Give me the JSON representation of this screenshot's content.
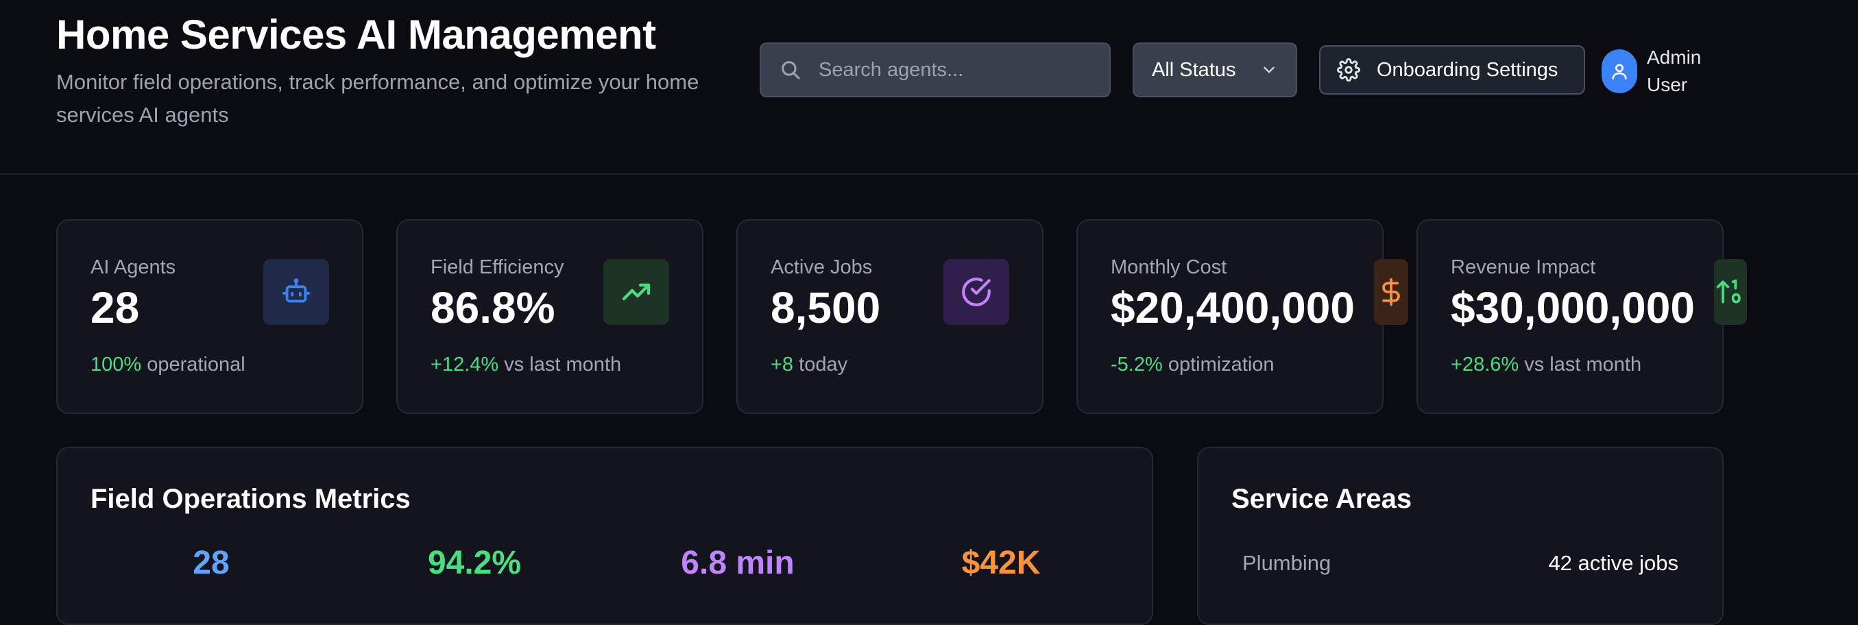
{
  "header": {
    "title": "Home Services AI Management",
    "subtitle": "Monitor field operations, track performance, and optimize your home services AI agents",
    "search_placeholder": "Search agents...",
    "status_filter": "All Status",
    "onboarding_label": "Onboarding Settings",
    "user_name": "Admin User"
  },
  "stats": [
    {
      "label": "AI Agents",
      "value": "28",
      "delta": "100%",
      "delta_text": " operational",
      "icon": "robot-icon",
      "accent": "#3b82f6"
    },
    {
      "label": "Field Efficiency",
      "value": "86.8%",
      "delta": "+12.4%",
      "delta_text": " vs last month",
      "icon": "trending-up-icon",
      "accent": "#4ade80"
    },
    {
      "label": "Active Jobs",
      "value": "8,500",
      "delta": "+8",
      "delta_text": " today",
      "icon": "check-circle-icon",
      "accent": "#a855f7"
    },
    {
      "label": "Monthly Cost",
      "value": "$20,400,000",
      "delta": "-5.2%",
      "delta_text": " optimization",
      "icon": "dollar-icon",
      "accent": "#fb923c"
    },
    {
      "label": "Revenue Impact",
      "value": "$30,000,000",
      "delta": "+28.6%",
      "delta_text": " vs last month",
      "icon": "sort-up-icon",
      "accent": "#4ade80"
    }
  ],
  "field_ops": {
    "title": "Field Operations Metrics",
    "metrics": [
      {
        "value": "28",
        "color": "#60a5fa"
      },
      {
        "value": "94.2%",
        "color": "#4ade80"
      },
      {
        "value": "6.8 min",
        "color": "#c084fc"
      },
      {
        "value": "$42K",
        "color": "#fb923c"
      }
    ]
  },
  "service_areas": {
    "title": "Service Areas",
    "rows": [
      {
        "name": "Plumbing",
        "jobs": "42 active jobs"
      }
    ]
  }
}
